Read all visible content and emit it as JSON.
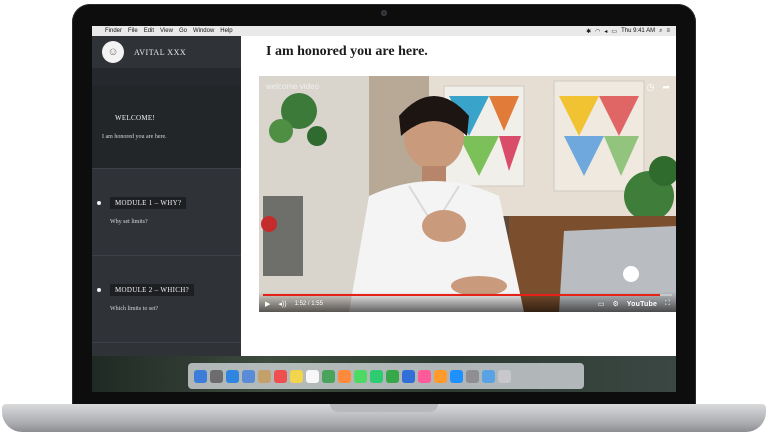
{
  "menubar": {
    "apple": "",
    "items": [
      "Finder",
      "File",
      "Edit",
      "View",
      "Go",
      "Window",
      "Help"
    ],
    "clock": "Thu 9:41 AM"
  },
  "sidebar": {
    "user": {
      "name": "AVITAL XXX"
    },
    "modules": [
      {
        "title": "WELCOME!",
        "subtitle": "I am honored you are here."
      },
      {
        "title": "MODULE 1 – WHY?",
        "subtitle": "Why set limits?"
      },
      {
        "title": "MODULE 2 – WHICH?",
        "subtitle": "Which limits to set?"
      }
    ]
  },
  "main": {
    "title": "I am honored you are here.",
    "video": {
      "label": "welcome video",
      "time": "1:52 / 1:55",
      "progress": 0.97,
      "brand": "YouTube"
    }
  },
  "colors": {
    "sidebar_bg": "#2f3338",
    "accent": "#e62117",
    "menubar_bg": "#e9e9ea"
  },
  "dock": {
    "icons": [
      "finder-icon",
      "launchpad-icon",
      "safari-icon",
      "mail-icon",
      "contacts-icon",
      "calendar-icon",
      "notes-icon",
      "reminders-icon",
      "maps-icon",
      "photos-icon",
      "messages-icon",
      "facetime-icon",
      "numbers-icon",
      "keynote-icon",
      "itunes-icon",
      "ibooks-icon",
      "app-store-icon",
      "preferences-icon",
      "folder-icon",
      "trash-icon"
    ]
  }
}
